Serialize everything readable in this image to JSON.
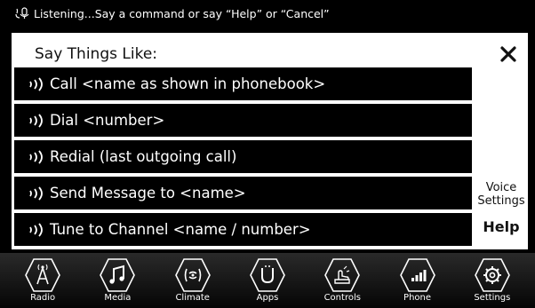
{
  "status": {
    "icon": "voice-mic-icon",
    "text": "Listening...Say a command or say “Help” or “Cancel”"
  },
  "panel": {
    "title": "Say Things Like:",
    "close_icon": "close-icon",
    "commands": [
      {
        "label": "Call <name as shown in phonebook>",
        "icon": "voice-wave-icon"
      },
      {
        "label": "Dial <number>",
        "icon": "voice-wave-icon"
      },
      {
        "label": "Redial (last outgoing call)",
        "icon": "voice-wave-icon"
      },
      {
        "label": "Send Message to <name>",
        "icon": "voice-wave-icon"
      },
      {
        "label": "Tune to Channel <name / number>",
        "icon": "voice-wave-icon"
      }
    ],
    "voice_settings_line1": "Voice",
    "voice_settings_line2": "Settings",
    "help_label": "Help"
  },
  "nav": {
    "items": [
      {
        "label": "Radio",
        "icon": "radio-icon"
      },
      {
        "label": "Media",
        "icon": "music-note-icon"
      },
      {
        "label": "Climate",
        "icon": "climate-icon"
      },
      {
        "label": "Apps",
        "icon": "apps-icon"
      },
      {
        "label": "Controls",
        "icon": "controls-icon"
      },
      {
        "label": "Phone",
        "icon": "phone-signal-icon"
      },
      {
        "label": "Settings",
        "icon": "gear-icon"
      }
    ]
  }
}
